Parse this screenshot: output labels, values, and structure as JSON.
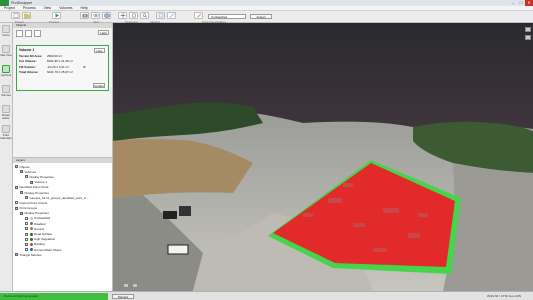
{
  "window": {
    "title": "Pix4Dmapper",
    "minimize": "–",
    "maximize": "□",
    "close": "✕"
  },
  "menu": [
    "Project",
    "Process",
    "View",
    "Volumes",
    "Help"
  ],
  "toolbar": {
    "groups": [
      {
        "caption": "Project",
        "buttons": [
          "new-project-icon",
          "open-project-icon"
        ]
      },
      {
        "caption": "Process",
        "buttons": [
          "process-icon"
        ]
      },
      {
        "caption": "View",
        "buttons": [
          "camera-icon",
          "eye-icon",
          "cube-icon"
        ]
      },
      {
        "caption": "Navigation",
        "buttons": [
          "move-icon",
          "rotate-icon",
          "zoom-icon"
        ]
      },
      {
        "caption": "Clipping",
        "buttons": [
          "clip-icon",
          "section-icon"
        ]
      },
      {
        "caption": "Point Cloud Editing",
        "buttons": [
          "edit-icon"
        ]
      }
    ],
    "class_select": "Unclassified",
    "assign_label": "Assign"
  },
  "sidebar": [
    {
      "label": "Home",
      "active": false
    },
    {
      "label": "Map View",
      "active": false
    },
    {
      "label": "rayCloud",
      "active": true
    },
    {
      "label": "Volumes",
      "active": false
    },
    {
      "label": "Mosaic Editor",
      "active": false
    },
    {
      "label": "Index Calculator",
      "active": false
    }
  ],
  "objects": {
    "header": "Objects",
    "help": "Help",
    "volume": {
      "name": "Volume 1",
      "rows": [
        {
          "key": "Terrain 3D Area:",
          "value": "2500.00 m²",
          "error": ""
        },
        {
          "key": "Cut Volume:",
          "value": "6251.96 ± 41.46 m³",
          "error": ""
        },
        {
          "key": "Fill Volume:",
          "value": "-10.20 ± 4.21 m³",
          "error": ""
        },
        {
          "key": "Total Volume:",
          "value": "6241.76 ± 45.67 m³",
          "error": ""
        }
      ],
      "help": "Help",
      "update": "Update"
    }
  },
  "layers": {
    "header": "Layers",
    "rows": [
      {
        "indent": 0,
        "label": "Objects",
        "checked": true
      },
      {
        "indent": 1,
        "label": "Volumes",
        "checked": true
      },
      {
        "indent": 2,
        "label": "Display Properties",
        "checked": true
      },
      {
        "indent": 3,
        "label": "Volume 1",
        "checked": true
      },
      {
        "indent": 0,
        "label": "Densified Point Cloud",
        "checked": true
      },
      {
        "indent": 1,
        "label": "Display Properties",
        "checked": true
      },
      {
        "indent": 2,
        "label": "Camera_04-11_group1_densified_point_cl...",
        "checked": true
      },
      {
        "indent": 0,
        "label": "Internal Point Clouds",
        "checked": false
      },
      {
        "indent": 0,
        "label": "Point Groups",
        "checked": true
      },
      {
        "indent": 1,
        "label": "Display Properties",
        "checked": true
      },
      {
        "indent": 2,
        "label": "Unclassified",
        "checked": false,
        "color": "#c8c8c8"
      },
      {
        "indent": 2,
        "label": "Disabled",
        "checked": false,
        "color": "#6b6b6b"
      },
      {
        "indent": 2,
        "label": "Ground",
        "checked": false,
        "color": "#a57a3b"
      },
      {
        "indent": 2,
        "label": "Road Surface",
        "checked": false,
        "color": "#4d4d4d"
      },
      {
        "indent": 2,
        "label": "High Vegetation",
        "checked": false,
        "color": "#1a7a1a"
      },
      {
        "indent": 2,
        "label": "Building",
        "checked": false,
        "color": "#d23c3c"
      },
      {
        "indent": 2,
        "label": "Human Made Object",
        "checked": false,
        "color": "#2a5cb8"
      },
      {
        "indent": 0,
        "label": "Triangle Meshes",
        "checked": true
      }
    ]
  },
  "status": {
    "progress_text": "Textured Mesh generated",
    "progress": 1.0,
    "done_button": "Dismiss",
    "coords": "WGS 84 / UTM zone 33N"
  }
}
